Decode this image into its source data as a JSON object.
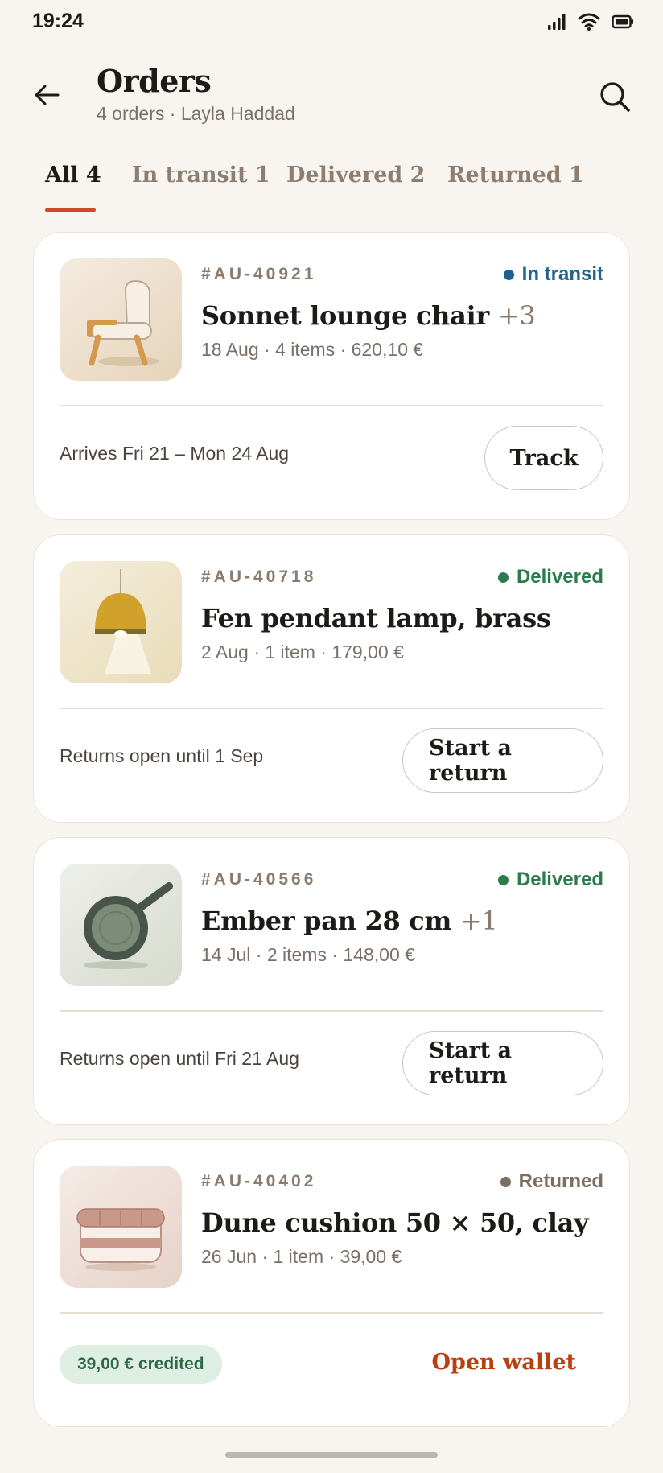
{
  "status_bar": {
    "time": "19:24"
  },
  "header": {
    "title": "Orders",
    "subtitle": "4 orders · Layla Haddad"
  },
  "tabs": [
    {
      "label": "All 4",
      "active": true
    },
    {
      "label": "In transit 1",
      "active": false
    },
    {
      "label": "Delivered 2",
      "active": false
    },
    {
      "label": "Returned 1",
      "active": false
    }
  ],
  "orders": [
    {
      "id": "#AU-40921",
      "status": "In transit",
      "status_color": "#1d6390",
      "product": "Sonnet lounge chair",
      "extra": "+3",
      "meta": "18 Aug · 4 items · 620,10 €",
      "note": "Arrives Fri 21 – Mon 24 Aug",
      "action": "Track",
      "thumb_icon": "lounge-chair-icon"
    },
    {
      "id": "#AU-40718",
      "status": "Delivered",
      "status_color": "#2d7a4e",
      "product": "Fen pendant lamp, brass",
      "extra": "",
      "meta": "2 Aug · 1 item · 179,00 €",
      "note": "Returns open until 1 Sep",
      "action": "Start a return",
      "thumb_icon": "pendant-lamp-icon"
    },
    {
      "id": "#AU-40566",
      "status": "Delivered",
      "status_color": "#2d7a4e",
      "product": "Ember pan 28 cm",
      "extra": "+1",
      "meta": "14 Jul · 2 items · 148,00 €",
      "note": "Returns open until Fri 21 Aug",
      "action": "Start a return",
      "thumb_icon": "frying-pan-icon"
    },
    {
      "id": "#AU-40402",
      "status": "Returned",
      "status_color": "#7d6e62",
      "product": "Dune cushion 50 × 50, clay",
      "extra": "",
      "meta": "26 Jun · 1 item · 39,00 €",
      "credit": "39,00 € credited",
      "action": "Open wallet",
      "thumb_icon": "cushion-icon"
    }
  ]
}
